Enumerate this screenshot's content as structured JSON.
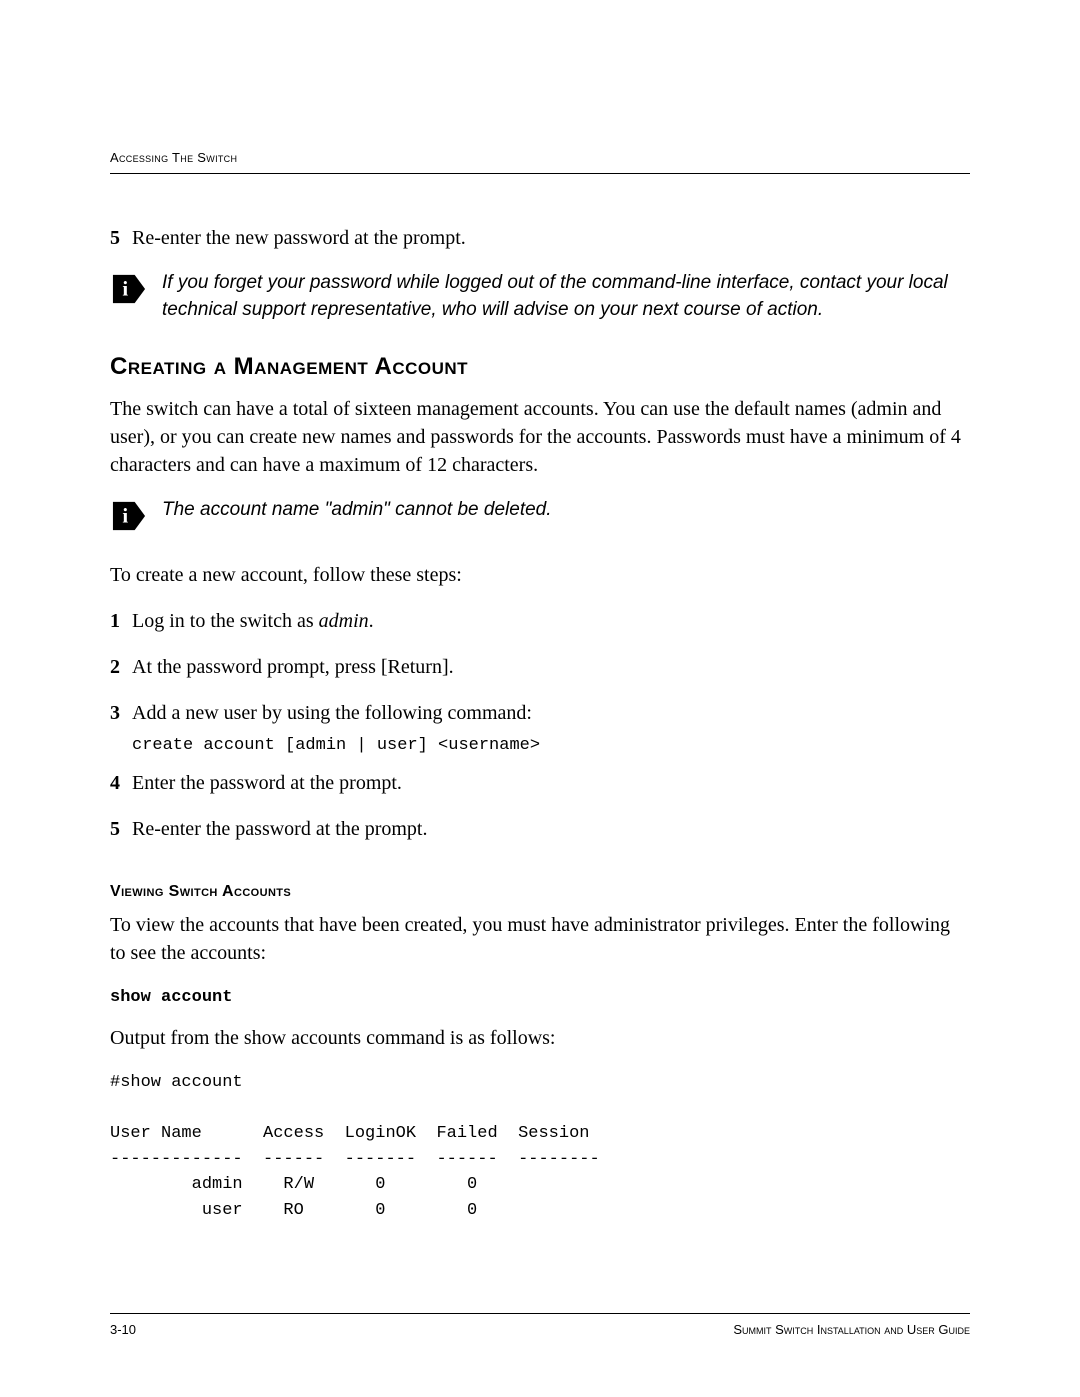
{
  "header": {
    "text": "Accessing The Switch"
  },
  "top_step": {
    "num": "5",
    "text": "Re-enter the new password at the prompt."
  },
  "note1": "If you forget your password while logged out of the command-line interface, contact your local technical support representative, who will advise on your next course of action.",
  "heading1": "Creating a Management Account",
  "para1": "The switch can have a total of sixteen management accounts. You can use the default names (admin and user), or you can create new names and passwords for the accounts. Passwords must have a minimum of 4 characters and can have a maximum of 12 characters.",
  "note2": "The account name \"admin\" cannot be deleted.",
  "para2": "To create a new account, follow these steps:",
  "steps": [
    {
      "num": "1",
      "pre": "Log in to the switch as ",
      "em": "admin",
      "post": "."
    },
    {
      "num": "2",
      "text": "At the password prompt, press [Return]."
    },
    {
      "num": "3",
      "text": "Add a new user by using the following command:"
    }
  ],
  "cmd1": "create account [admin | user] <username>",
  "steps_b": [
    {
      "num": "4",
      "text": "Enter the password at the prompt."
    },
    {
      "num": "5",
      "text": "Re-enter the password at the prompt."
    }
  ],
  "heading2": "Viewing Switch Accounts",
  "para3": "To view the accounts that have been created, you must have administrator privileges. Enter the following to see the accounts:",
  "cmd2": "show account",
  "para4": "Output from the show accounts command is as follows:",
  "output": "#show account\n\nUser Name      Access  LoginOK  Failed  Session\n-------------  ------  -------  ------  --------\n        admin    R/W      0        0\n         user    RO       0        0",
  "footer": {
    "left": "3-10",
    "right": "Summit Switch Installation and User Guide"
  }
}
